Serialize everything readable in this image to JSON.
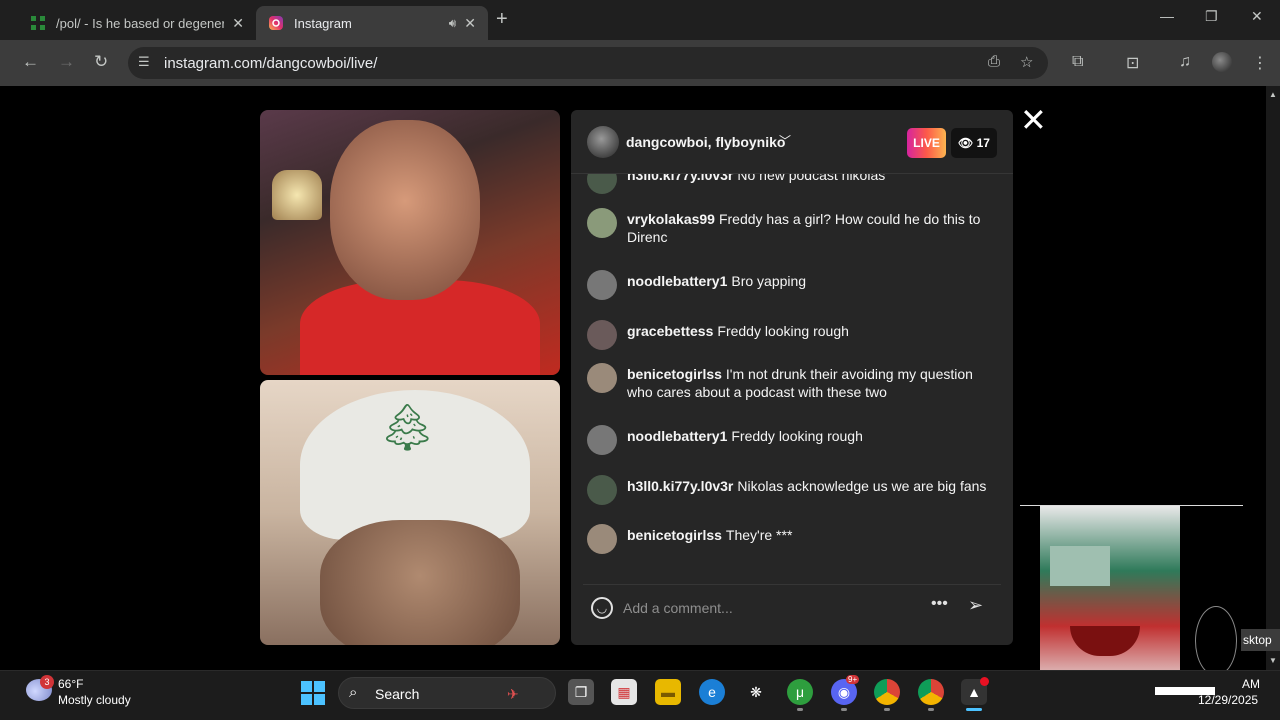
{
  "browser": {
    "tabs": [
      {
        "title": "/pol/ - Is he based or degenerate",
        "active": false
      },
      {
        "title": "Instagram",
        "active": true
      }
    ],
    "new_tab_label": "+",
    "url": "instagram.com/dangcowboi/live/"
  },
  "live": {
    "hosts": "dangcowboi, flyboyniko",
    "live_label": "LIVE",
    "viewer_count": "17",
    "comments": [
      {
        "user": "h3ll0.ki77y.l0v3r",
        "text": "No new podcast nikolas",
        "avatar_color": "#4a5a4a"
      },
      {
        "user": "vrykolakas99",
        "text": "Freddy has a girl? How could he do this to Direnc",
        "avatar_color": "#8a9a7a"
      },
      {
        "user": "noodlebattery1",
        "text": "Bro yapping",
        "avatar_color": "#777777"
      },
      {
        "user": "gracebettess",
        "text": "Freddy looking rough",
        "avatar_color": "#6a5a5a"
      },
      {
        "user": "benicetogirlss",
        "text": "I'm not drunk their avoiding my question who cares about a podcast with these two",
        "avatar_color": "#9a8a7a"
      },
      {
        "user": "noodlebattery1",
        "text": "Freddy looking rough",
        "avatar_color": "#777777"
      },
      {
        "user": "h3ll0.ki77y.l0v3r",
        "text": "Nikolas acknowledge us we are big fans",
        "avatar_color": "#4a5a4a"
      },
      {
        "user": "benicetogirlss",
        "text": "They're ***",
        "avatar_color": "#9a8a7a"
      }
    ],
    "comment_placeholder": "Add a comment...",
    "more_label": "•••"
  },
  "overlay": {
    "desktop_label": "sktop"
  },
  "taskbar": {
    "weather_badge": "3",
    "temperature": "66°F",
    "condition": "Mostly cloudy",
    "search_label": "Search",
    "clock_time": "AM",
    "clock_date": "12/29/2025",
    "discord_badge": "9+"
  }
}
